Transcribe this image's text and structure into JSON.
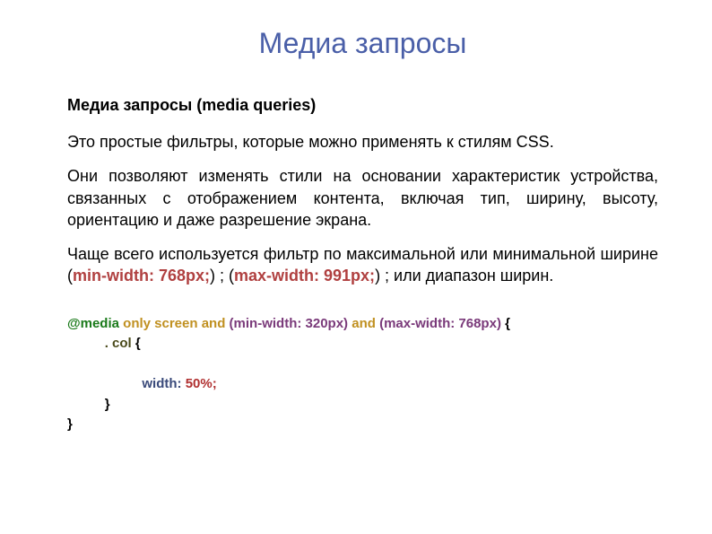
{
  "title": "Медиа запросы",
  "subtitle": "Медиа запросы (media queries)",
  "para1": "Это простые фильтры, которые можно применять к стилям CSS.",
  "para2": "Они позволяют изменять стили на основании характеристик устройства, связанных с отображением контента, включая тип, ширину, высоту, ориентацию и даже разрешение экрана.",
  "para3_a": "Чаще всего используется фильтр по максимальной или минимальной ширине (",
  "para3_hi1": "min-width: 768px;",
  "para3_b": ") ; (",
  "para3_hi2": "max-width: 991px;",
  "para3_c": ") ; или диапазон ширин.",
  "code": {
    "media": "@media",
    "only_screen_and": "only screen and",
    "cond1": "(min-width: 320px)",
    "and": "and",
    "cond2": "(max-width: 768px)",
    "open": "{",
    "selector": ". col",
    "open2": "{",
    "prop": "width:",
    "val": "50%;",
    "close1": "}",
    "close2": "}"
  }
}
